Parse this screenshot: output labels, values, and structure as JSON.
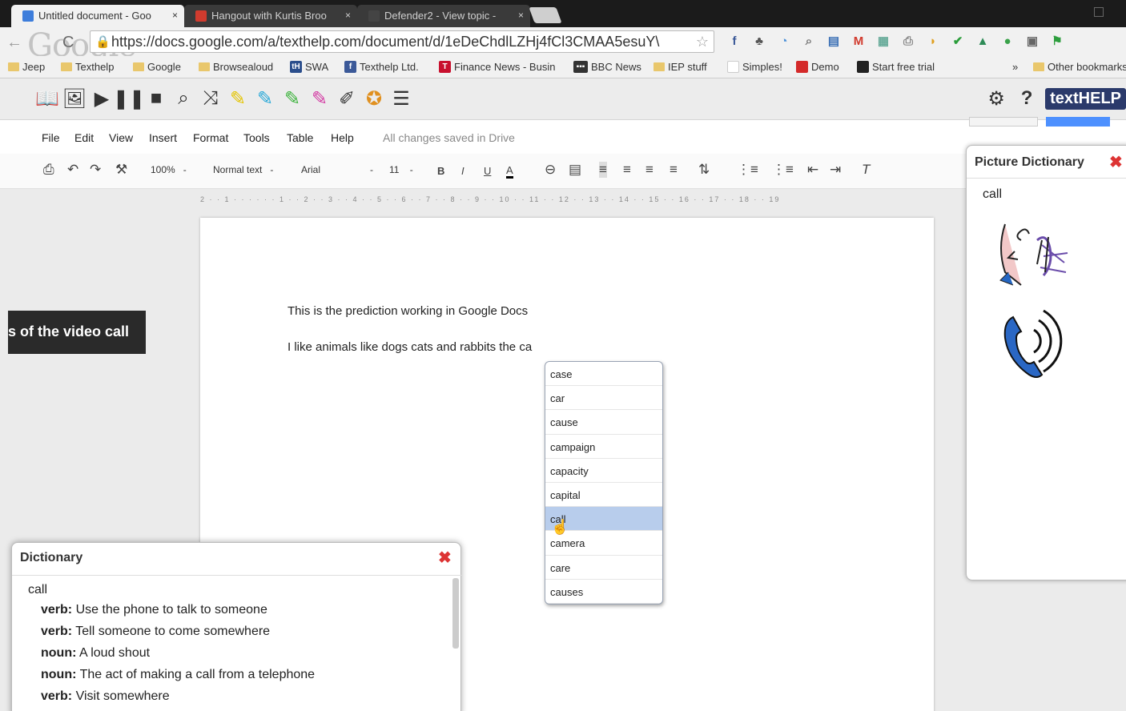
{
  "tabs": [
    {
      "label": "Untitled document - Goo",
      "color": "#3d7ddb"
    },
    {
      "label": "Hangout with Kurtis Broo",
      "color": "#d13b2e"
    },
    {
      "label": "Defender2 - View topic -",
      "color": "#444444"
    }
  ],
  "omnibox": {
    "url": "https://docs.google.com/a/texthelp.com/document/d/1eDeChdlLZHj4fCl3CMAA5esuY\\"
  },
  "google_watermark": "Google",
  "bookmarks": [
    "Jeep",
    "Texthelp",
    "Google",
    "Browsealoud",
    "SWA",
    "Texthelp Ltd.",
    "Finance News - Busin",
    "BBC News",
    "IEP stuff",
    "Simples!",
    "Demo",
    "Start free trial",
    "Other bookmarks"
  ],
  "bookmark_overflow": "»",
  "texthelp_logo": "textHELP",
  "menu": [
    "File",
    "Edit",
    "View",
    "Insert",
    "Format",
    "Tools",
    "Table",
    "Help"
  ],
  "saved_message": "All changes saved in Drive",
  "format": {
    "zoom": "100%",
    "style": "Normal text",
    "font": "Arial",
    "size": "11"
  },
  "ruler": "2 · · 1 · · · · · · 1 · · 2 · · 3 · · 4 · · 5 · · 6 · · 7 · · 8 · · 9 · · 10 · · 11 · · 12 · · 13 · · 14 · · 15 · · 16 · · 17 · · 18 · · 19",
  "document": {
    "line1": "This is the prediction working in Google Docs",
    "line2": "I like animals like dogs cats and rabbits the ca"
  },
  "caption": "s of the video call",
  "prediction": {
    "items": [
      "case",
      "car",
      "cause",
      "campaign",
      "capacity",
      "capital",
      "call",
      "camera",
      "care",
      "causes"
    ],
    "selected": "call"
  },
  "picture_dictionary": {
    "title": "Picture Dictionary",
    "word": "call"
  },
  "dictionary": {
    "title": "Dictionary",
    "word": "call",
    "definitions": [
      {
        "pos": "verb:",
        "text": " Use the phone to talk to someone"
      },
      {
        "pos": "verb:",
        "text": " Tell someone to come somewhere"
      },
      {
        "pos": "noun:",
        "text": " A loud shout"
      },
      {
        "pos": "noun:",
        "text": " The act of making a call from a telephone"
      },
      {
        "pos": "verb:",
        "text": " Visit somewhere"
      }
    ]
  }
}
